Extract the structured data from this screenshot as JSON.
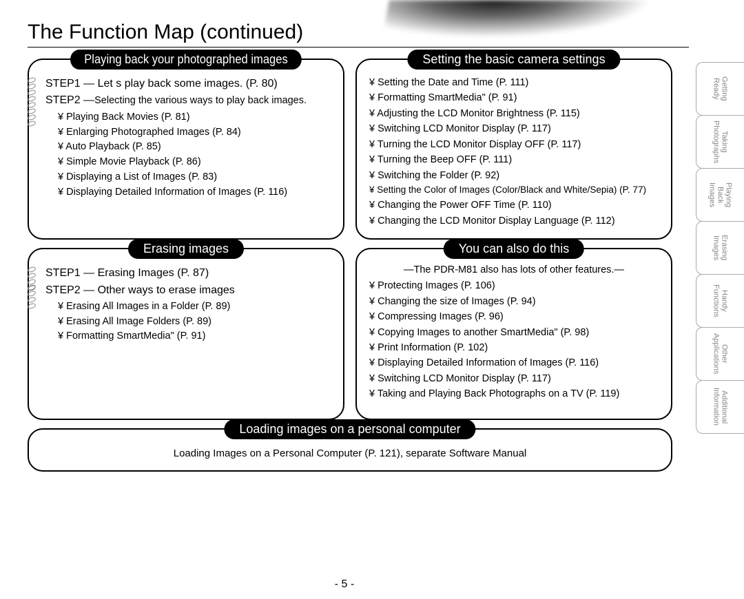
{
  "title": "The Function Map (continued)",
  "page_number": "- 5 -",
  "side_tabs": [
    "Getting\nReady",
    "Taking\nPhotographs",
    "Playing\nBack Images",
    "Erasing\nImages",
    "Handy\nFunctions",
    "Other\nApplications",
    "Additional\nInformation"
  ],
  "panel_playing": {
    "pill": "Playing back your photographed images",
    "step1": "STEP1 — Let s play back some images. (P. 80)",
    "step2_prefix": "STEP2 —",
    "step2_rest": "Selecting the various ways to play back images.",
    "items": [
      "¥ Playing Back Movies (P. 81)",
      "¥ Enlarging Photographed Images (P. 84)",
      "¥ Auto Playback (P. 85)",
      "¥ Simple Movie Playback (P. 86)",
      "¥ Displaying a List of Images (P. 83)",
      "¥ Displaying Detailed Information of Images (P. 116)"
    ]
  },
  "panel_settings": {
    "pill": "Setting the basic camera settings",
    "items": [
      "¥ Setting the Date and Time (P. 111)",
      "¥ Formatting SmartMedia\" (P. 91)",
      "¥ Adjusting the LCD Monitor Brightness (P. 115)",
      "¥ Switching LCD Monitor Display (P. 117)",
      "¥ Turning the LCD Monitor Display OFF (P. 117)",
      "¥ Turning the Beep OFF (P. 111)",
      "¥ Switching the Folder (P. 92)",
      "¥ Setting the Color of Images (Color/Black and White/Sepia) (P. 77)",
      "¥ Changing the Power OFF Time (P. 110)",
      "¥ Changing the LCD Monitor Display Language (P. 112)"
    ]
  },
  "panel_erasing": {
    "pill": "Erasing images",
    "step1": "STEP1 — Erasing Images (P. 87)",
    "step2": "STEP2 — Other ways to erase images",
    "items": [
      "¥ Erasing All Images in a Folder (P. 89)",
      "¥ Erasing All Image Folders (P. 89)",
      "¥ Formatting SmartMedia\" (P. 91)"
    ]
  },
  "panel_also": {
    "pill": "You can also do this",
    "subtitle": "—The PDR-M81 also has lots of other features.—",
    "items": [
      "¥ Protecting Images (P. 106)",
      "¥ Changing the size of Images (P. 94)",
      "¥ Compressing Images (P. 96)",
      "¥ Copying Images to another SmartMedia\" (P. 98)",
      "¥ Print Information (P. 102)",
      "¥ Displaying Detailed Information of Images (P. 116)",
      "¥ Switching LCD Monitor Display (P. 117)",
      "¥ Taking and Playing Back Photographs on a TV (P. 119)"
    ]
  },
  "panel_loading": {
    "pill": "Loading images on a personal computer",
    "text": "Loading Images on a Personal Computer (P. 121), separate  Software Manual"
  }
}
